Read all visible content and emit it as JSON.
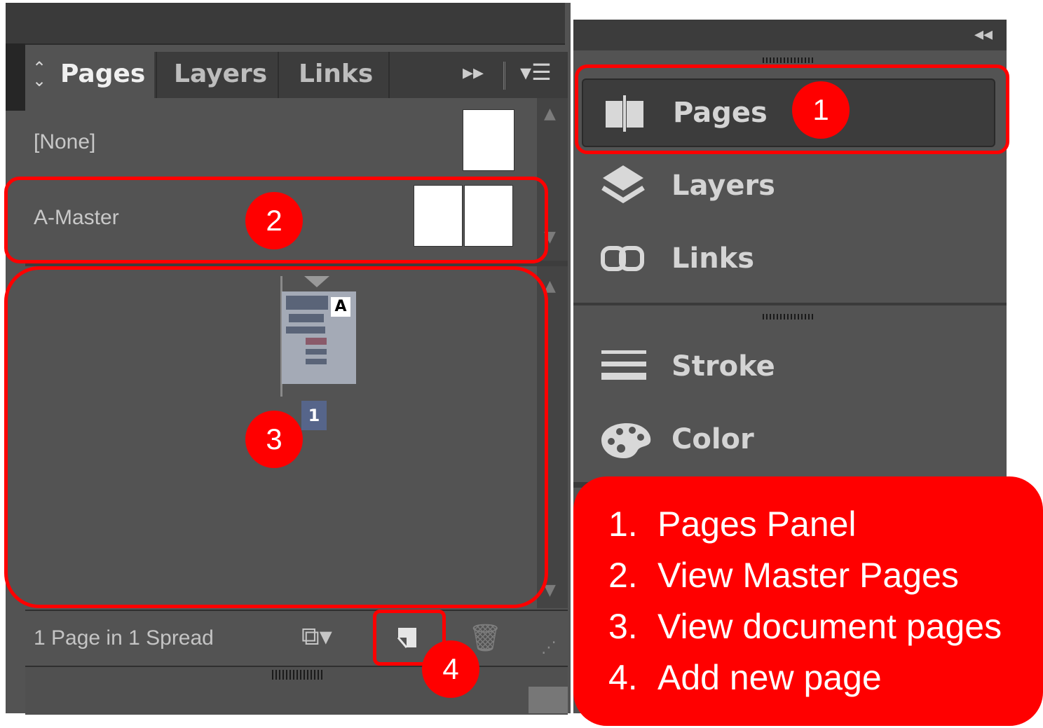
{
  "pages_panel": {
    "tabs": [
      {
        "label": "Pages"
      },
      {
        "label": "Layers"
      },
      {
        "label": "Links"
      }
    ],
    "masters": [
      {
        "label": "[None]"
      },
      {
        "label": "A-Master"
      }
    ],
    "document_pages": [
      {
        "number": "1",
        "master_prefix": "A"
      }
    ],
    "status": "1 Page in 1 Spread"
  },
  "panel_dock": {
    "items": [
      {
        "label": "Pages",
        "icon": "pages-icon"
      },
      {
        "label": "Layers",
        "icon": "layers-icon"
      },
      {
        "label": "Links",
        "icon": "links-icon"
      },
      {
        "label": "Stroke",
        "icon": "stroke-icon"
      },
      {
        "label": "Color",
        "icon": "color-palette-icon"
      }
    ]
  },
  "annotations": {
    "badges": [
      "1",
      "2",
      "3",
      "4"
    ],
    "legend": [
      {
        "num": "1.",
        "text": "Pages Panel"
      },
      {
        "num": "2.",
        "text": "View Master Pages"
      },
      {
        "num": "3.",
        "text": "View document pages"
      },
      {
        "num": "4.",
        "text": "Add new page"
      }
    ]
  },
  "colors": {
    "panel_bg": "#535353",
    "tab_bar_bg": "#3c3c3c",
    "annotation_red": "#ff0000"
  }
}
